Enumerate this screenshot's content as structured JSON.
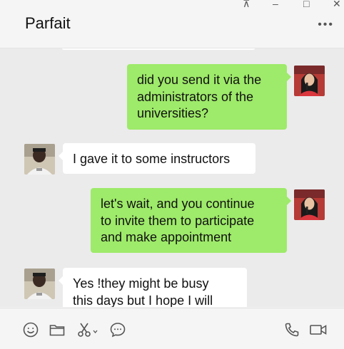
{
  "chat": {
    "title": "Parfait"
  },
  "window_controls": {
    "pin": "⊼",
    "minimize": "–",
    "maximize": "□",
    "close": "✕"
  },
  "header": {
    "more_label": "•••"
  },
  "messages": [
    {
      "sender": "me",
      "avatar": "female-avatar",
      "lines": [
        "did you send it via the",
        "administrators of the",
        "universities?"
      ]
    },
    {
      "sender": "them",
      "avatar": "male-avatar",
      "lines": [
        "I gave it to some instructors"
      ]
    },
    {
      "sender": "me",
      "avatar": "female-avatar",
      "lines": [
        "let's wait, and you continue",
        "to invite them to participate",
        "and make appointment"
      ]
    },
    {
      "sender": "them",
      "avatar": "male-avatar",
      "lines": [
        "Yes !they might be busy",
        "this days  but I hope I will"
      ]
    }
  ],
  "toolbar": {
    "icons": [
      "emoji-icon",
      "folder-icon",
      "scissors-icon",
      "chat-history-icon",
      "phone-icon",
      "video-icon"
    ]
  },
  "colors": {
    "sent_bubble": "#9eea6a",
    "received_bubble": "#ffffff",
    "chat_bg": "#ebebeb"
  }
}
